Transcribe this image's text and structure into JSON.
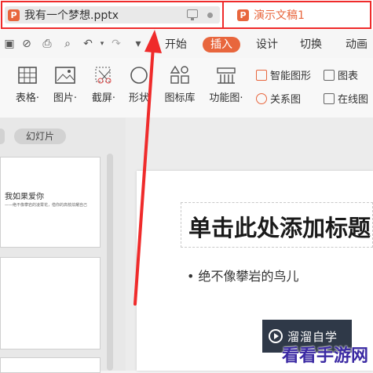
{
  "tabs": {
    "doc1": {
      "logo": "P",
      "name": "我有一个梦想.pptx"
    },
    "doc2": {
      "logo": "P",
      "name": "演示文稿1"
    }
  },
  "menu": {
    "dropdown_glyph": "▾",
    "items": [
      "开始",
      "插入",
      "设计",
      "切换",
      "动画"
    ],
    "active": "插入"
  },
  "ribbon": {
    "buttons": [
      {
        "label": "表格·",
        "icon": "table-icon"
      },
      {
        "label": "图片·",
        "icon": "picture-icon"
      },
      {
        "label": "截屏·",
        "icon": "screenshot-icon"
      },
      {
        "label": "形状",
        "icon": "shape-icon"
      },
      {
        "label": "图标库",
        "icon": "icon-library-icon"
      },
      {
        "label": "功能图·",
        "icon": "function-chart-icon"
      }
    ],
    "small": [
      {
        "label": "智能图形",
        "icon": "smart-art-icon"
      },
      {
        "label": "图表",
        "icon": "chart-icon"
      },
      {
        "label": "关系图",
        "icon": "relation-icon"
      },
      {
        "label": "在线图",
        "icon": "online-chart-icon"
      }
    ]
  },
  "panel": {
    "pill_label": "幻灯片"
  },
  "thumbnails": {
    "slide1_title": "我如果爱你",
    "slide1_subtitle": "——绝不像攀岩的凌霄花，借你的高枝炫耀自己"
  },
  "slide": {
    "title_placeholder": "单击此处添加标题",
    "bullet": "•  绝不像攀岩的鸟儿"
  },
  "watermarks": {
    "wm1": "溜溜自学",
    "wm2": "看看手游网"
  },
  "colors": {
    "accent": "#e8663d",
    "annotation": "#ef2b2b"
  }
}
